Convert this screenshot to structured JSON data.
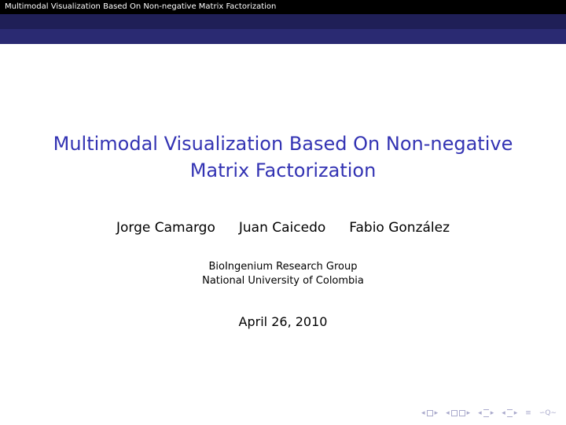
{
  "header": {
    "short_title": "Multimodal Visualization Based On Non-negative Matrix Factorization"
  },
  "title_slide": {
    "title_line_1": "Multimodal Visualization Based On Non-negative",
    "title_line_2": "Matrix Factorization",
    "authors": [
      "Jorge Camargo",
      "Juan Caicedo",
      "Fabio González"
    ],
    "institute_line_1": "BioIngenium Research Group",
    "institute_line_2": "National University of Colombia",
    "date": "April 26, 2010"
  },
  "colors": {
    "headline_bg": "#000000",
    "bar_dark": "#1f1f57",
    "bar_mid": "#2a2a72",
    "title_color": "#3333b3",
    "nav_color": "#aaaacc"
  },
  "navigation": {
    "icons": [
      "slide-nav-icon",
      "frame-nav-icon",
      "subsection-nav-icon",
      "section-nav-icon",
      "align-icon",
      "search-icon"
    ]
  }
}
